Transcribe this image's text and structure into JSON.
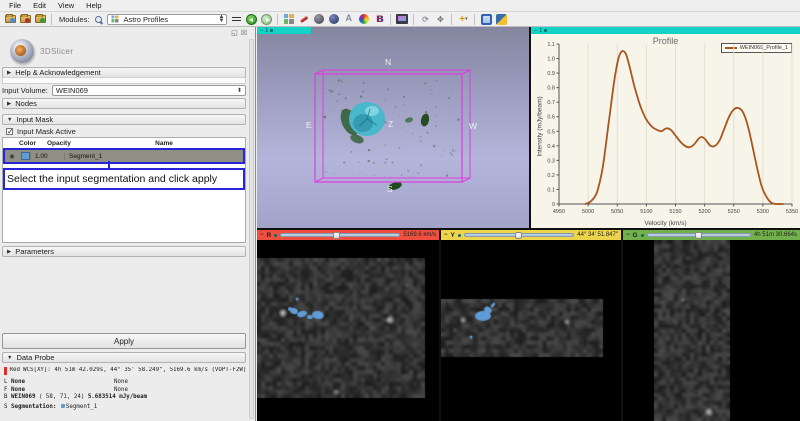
{
  "menu": {
    "items": [
      "File",
      "Edit",
      "View",
      "Help"
    ]
  },
  "toolbar": {
    "modules_label": "Modules:",
    "module_name": "Astro Profiles",
    "icons": [
      "load-data-icon",
      "save-data-icon",
      "add-data-icon",
      "module-search-icon",
      "module-history-icon",
      "back-icon",
      "forward-icon",
      "layout-icon",
      "annotate-icon",
      "models-icon",
      "volumes-icon",
      "measure-icon",
      "colors-icon",
      "editor-icon",
      "screenshot-icon",
      "mouse-rotate-icon",
      "mouse-translate-icon",
      "place-fiducial-icon",
      "extensions-icon",
      "python-console-icon"
    ]
  },
  "left_panel": {
    "logo_text": "3DSlicer",
    "help_section": "Help & Acknowledgement",
    "input_volume_label": "Input Volume:",
    "input_volume_value": "WEIN069",
    "nodes_section": "Nodes",
    "input_mask_section": "Input Mask",
    "input_mask_active": "Input Mask Active",
    "seg_table": {
      "headers": {
        "color": "Color",
        "opacity": "Opacity",
        "name": "Name"
      },
      "row": {
        "opacity": "1.00",
        "name": "Segment_1",
        "color_hex": "#5f9bd4"
      }
    },
    "annotation_text": "Select the input segmentation and click apply",
    "parameters_section": "Parameters",
    "apply_label": "Apply",
    "data_probe": {
      "title": "Data Probe",
      "red_label": "Red",
      "red_text": "WCS[XY]:  4h 51m 42.029s, 44° 35' 58.249\", 5169.6 km/s (VOPT-F2W)",
      "l_prefix": "L",
      "l_name": "None",
      "l_value": "None",
      "f_prefix": "F",
      "f_name": "None",
      "f_value": "None",
      "b_prefix": "B",
      "b_name": "WEIN069",
      "b_coords": "(  58,   71,   24)",
      "b_value": "5.683514 mJy/beam",
      "s_prefix": "S",
      "s_name": "Segmentation:",
      "s_value": "Segment_1"
    }
  },
  "view3d": {
    "view_id": "1",
    "labels": {
      "n": "N",
      "e": "E",
      "w": "W",
      "s": "S",
      "z": "Z"
    },
    "box_color": "#e23ae2"
  },
  "chart_view": {
    "view_id": "1"
  },
  "chart_data": {
    "type": "line",
    "title": "Profile",
    "xlabel": "Velocity (km/s)",
    "ylabel": "Intensity (mJy/beam)",
    "xlim": [
      4950,
      5350
    ],
    "ylim": [
      0,
      1.1
    ],
    "xticks": [
      4950,
      5000,
      5050,
      5100,
      5150,
      5200,
      5250,
      5300,
      5350
    ],
    "yticks": [
      0,
      0.1,
      0.2,
      0.3,
      0.4,
      0.5,
      0.6,
      0.7,
      0.8,
      0.9,
      1.0,
      1.1
    ],
    "grid": "vertical",
    "legend_position": "top-right",
    "series": [
      {
        "name": "WEIN069_Profile_1",
        "color": "#a9551e",
        "x": [
          4995,
          5005,
          5015,
          5025,
          5035,
          5045,
          5052,
          5058,
          5065,
          5072,
          5080,
          5090,
          5100,
          5110,
          5118,
          5126,
          5134,
          5142,
          5150,
          5158,
          5166,
          5174,
          5182,
          5190,
          5196,
          5202,
          5210,
          5218,
          5226,
          5234,
          5242,
          5250,
          5258,
          5266,
          5274,
          5282,
          5290,
          5298,
          5306,
          5314,
          5322,
          5335
        ],
        "y": [
          0.0,
          0.02,
          0.08,
          0.25,
          0.55,
          0.85,
          1.0,
          1.05,
          1.03,
          0.93,
          0.8,
          0.67,
          0.58,
          0.53,
          0.51,
          0.5,
          0.52,
          0.51,
          0.47,
          0.43,
          0.4,
          0.39,
          0.41,
          0.45,
          0.46,
          0.44,
          0.4,
          0.4,
          0.44,
          0.52,
          0.6,
          0.65,
          0.66,
          0.63,
          0.54,
          0.4,
          0.25,
          0.12,
          0.05,
          0.01,
          0.0,
          0.0
        ]
      }
    ]
  },
  "slices": [
    {
      "letter": "R",
      "value": "5169.6 km/s",
      "bar_color": "#ef4f3e",
      "handle_pos": 0.44
    },
    {
      "letter": "Y",
      "value": "44° 34' 51.847\"",
      "bar_color": "#ecd44c",
      "handle_pos": 0.46
    },
    {
      "letter": "G",
      "value": "4h 51m 30.664s",
      "bar_color": "#71b04b",
      "handle_pos": 0.46
    }
  ],
  "colors": {
    "accent_cyan": "#14d2c6",
    "annotation_blue": "#2626d8",
    "curve": "#a9551e",
    "segment_blue": "#5f9bd4"
  }
}
